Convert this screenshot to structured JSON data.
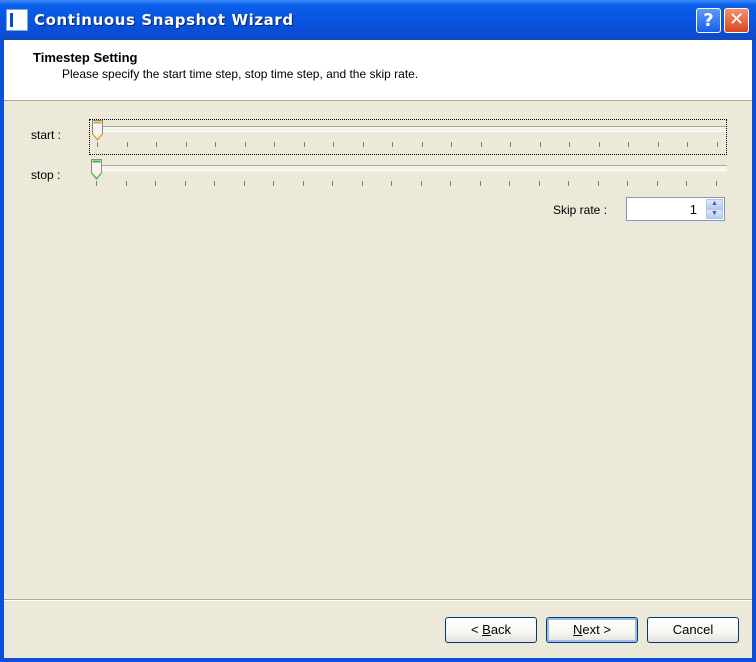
{
  "window": {
    "title": "Continuous Snapshot Wizard",
    "help_glyph": "?",
    "close_glyph": "✕",
    "icon": "app-logo-icon"
  },
  "header": {
    "title": "Timestep Setting",
    "subtitle": "Please specify the start time step, stop time step, and the skip rate."
  },
  "start": {
    "label": "start :",
    "position": 0
  },
  "stop": {
    "label": "stop :",
    "position": 0
  },
  "skip_rate": {
    "label": "Skip rate :",
    "value": "1",
    "up_glyph": "▲",
    "down_glyph": "▼"
  },
  "buttons": {
    "back": {
      "arrow": "< ",
      "mnemonic": "B",
      "rest": "ack"
    },
    "next": {
      "mnemonic": "N",
      "rest": "ext",
      "arrow": " >"
    },
    "cancel": "Cancel"
  },
  "colors": {
    "title_bar": "#0a50d8",
    "dialog_bg": "#ece9d8",
    "start_thumb_accent": "#f0a020",
    "stop_thumb_accent": "#3cb840"
  }
}
